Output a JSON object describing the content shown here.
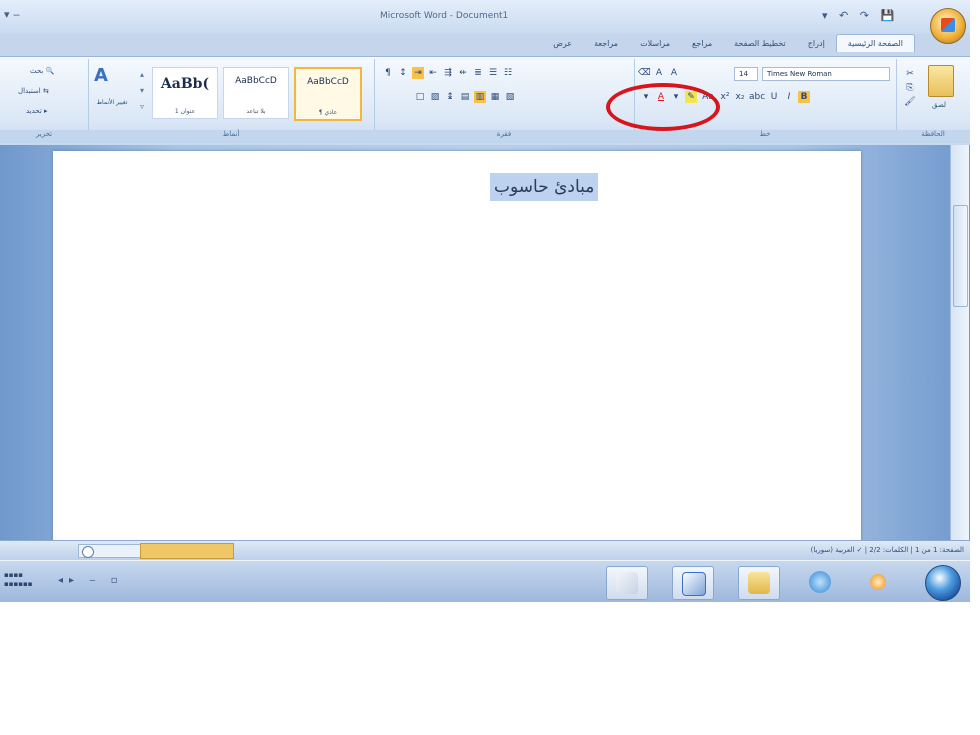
{
  "window": {
    "title": "Microsoft Word - Document1",
    "quick_access": "▾  ‒",
    "controls": "▾ ↶ ↷ 💾"
  },
  "tabs": [
    "الصفحة الرئيسية",
    "إدراج",
    "تخطيط الصفحة",
    "مراجع",
    "مراسلات",
    "مراجعة",
    "عرض"
  ],
  "ribbon": {
    "editing": {
      "find": "بحث",
      "replace": "استبدال",
      "select": "تحديد"
    },
    "change_styles": "تغيير الأنماط",
    "styles": [
      {
        "sample": "AaBbCcD",
        "name": "¶ عادي"
      },
      {
        "sample": "AaBbCcD",
        "name": "بلا تباعد"
      },
      {
        "sample": "AaBb(",
        "name": "عنوان 1"
      }
    ],
    "group_labels": {
      "editing": "تحرير",
      "styles": "أنماط",
      "paragraph": "فقرة",
      "font": "خط",
      "clipboard": "الحافظة"
    },
    "font_name": "Times New Roman",
    "font_size": "14",
    "paste": "لصق"
  },
  "document": {
    "text": "مبادئ حاسوب"
  },
  "statusbar": {
    "page": "الصفحة: 1 من 1",
    "words": "الكلمات: 2/2",
    "language": "العربية (سوريا)"
  },
  "colors": {
    "highlight_ring": "#d8141c",
    "selection": "#bcd2ee"
  }
}
